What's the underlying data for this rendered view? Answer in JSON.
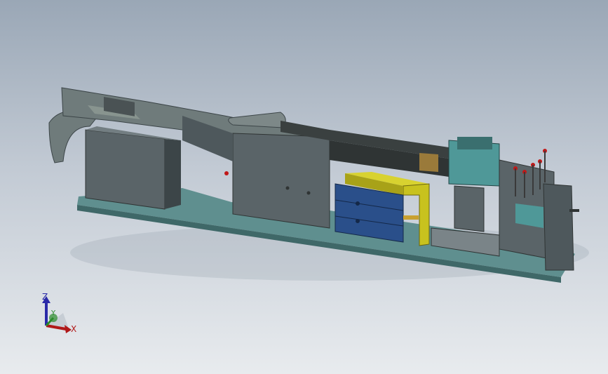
{
  "viewport": {
    "background_top": "#9aa7b6",
    "background_bottom": "#e8ebee"
  },
  "model": {
    "colors": {
      "base_plate": "#5f8f8f",
      "base_plate_dark": "#3f6868",
      "housing": "#5a6468",
      "housing_dark": "#3c4548",
      "chute": "#6f7b7b",
      "rail": "#2f3434",
      "yellow_bracket": "#c8c21e",
      "blue_cylinder": "#2a4f8a",
      "teal_block": "#4f9898",
      "red_pins": "#c01818",
      "bronze": "#9a7a3a"
    }
  },
  "triad": {
    "z_label": "Z",
    "y_label": "Y",
    "x_label": "X",
    "z_color": "#2a2aa8",
    "y_color": "#2a8a2a",
    "x_color": "#b01818"
  }
}
